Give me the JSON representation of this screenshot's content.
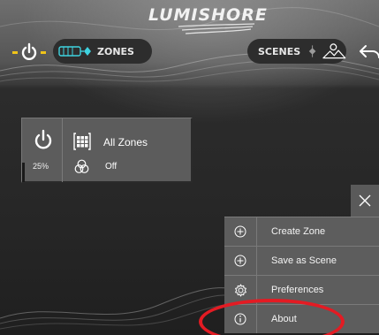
{
  "header": {
    "logo_text": "LUMISHORE",
    "zones_label": "ZONES",
    "scenes_label": "SCENES"
  },
  "zone_card": {
    "name": "All Zones",
    "brightness_text": "25%",
    "brightness": 0.25,
    "state": "Off"
  },
  "menu": {
    "items": [
      {
        "label": "Create Zone",
        "icon": "plus-circle-icon"
      },
      {
        "label": "Save as Scene",
        "icon": "plus-circle-icon"
      },
      {
        "label": "Preferences",
        "icon": "gear-icon"
      },
      {
        "label": "About",
        "icon": "info-circle-icon"
      }
    ]
  },
  "colors": {
    "accent_yellow": "#f0c419",
    "accent_cyan": "#3fd3e0",
    "annotation_red": "#e31b23"
  }
}
